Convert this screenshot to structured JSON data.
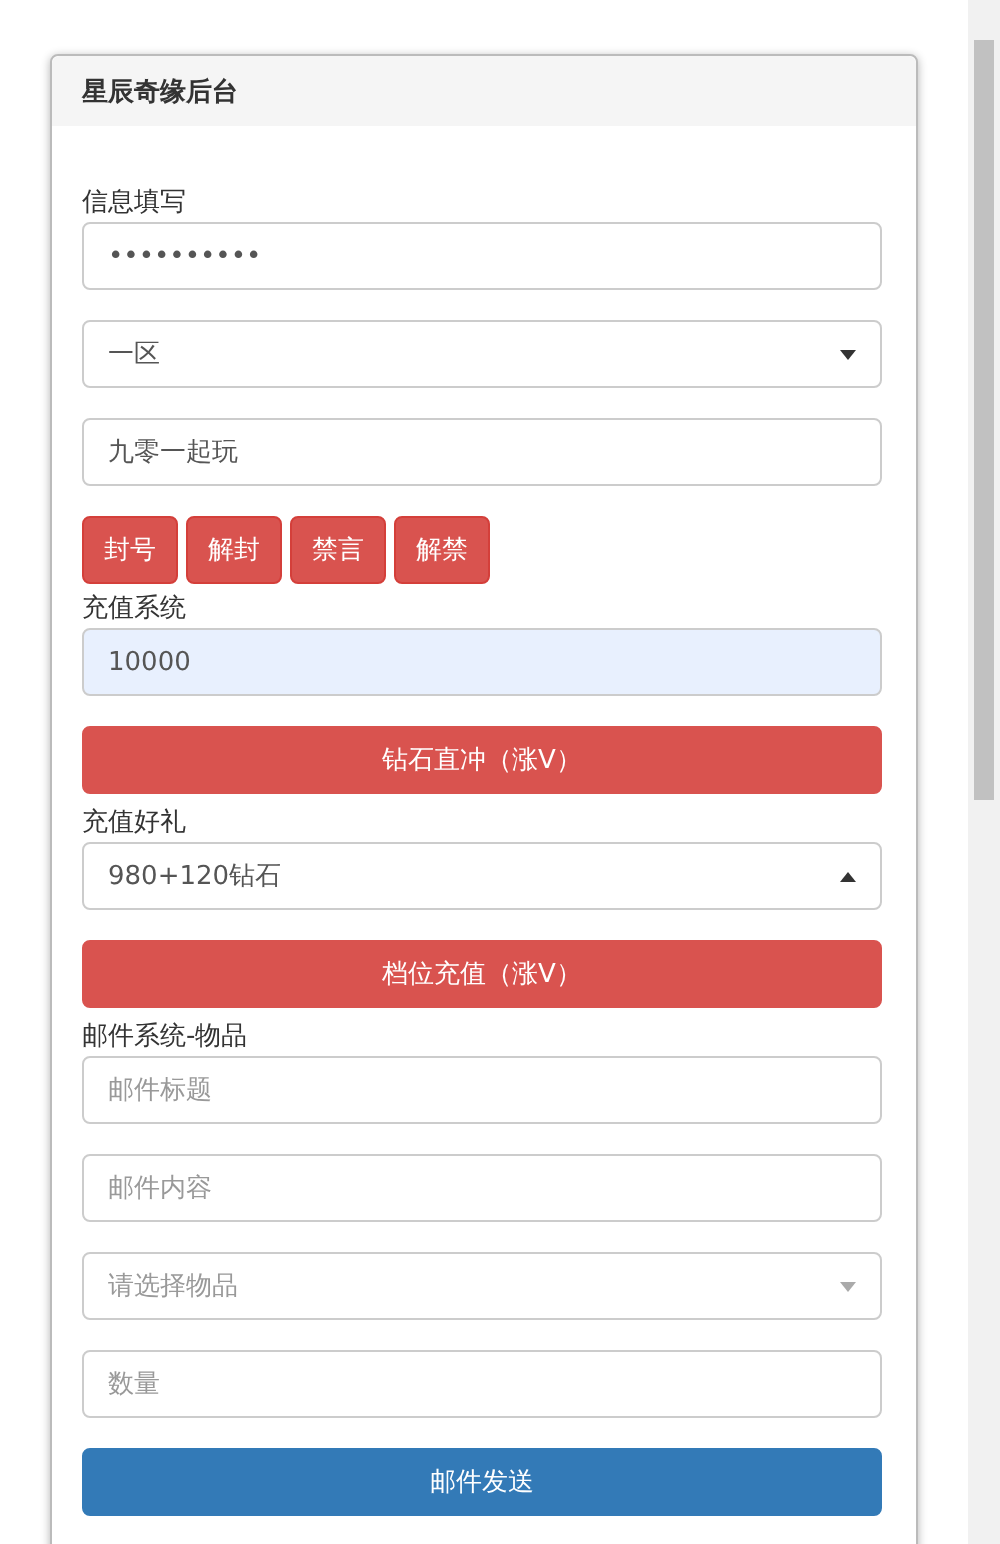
{
  "panel": {
    "title": "星辰奇缘后台"
  },
  "sections": [
    {
      "label": "信息填写",
      "items": [
        {
          "kind": "password",
          "value": "••••••••••"
        },
        {
          "kind": "select",
          "value": "一区",
          "expanded": false
        },
        {
          "kind": "text",
          "value": "九零一起玩"
        },
        {
          "kind": "buttons",
          "buttons": [
            "封号",
            "解封",
            "禁言",
            "解禁"
          ]
        }
      ]
    },
    {
      "label": "充值系统",
      "items": [
        {
          "kind": "text",
          "value": "10000",
          "autofilled": true
        },
        {
          "kind": "button",
          "label": "钻石直冲（涨V）",
          "color": "#d9534f"
        }
      ]
    },
    {
      "label": "充值好礼",
      "items": [
        {
          "kind": "select",
          "value": "980+120钻石",
          "expanded": true
        },
        {
          "kind": "button",
          "label": "档位充值（涨V）",
          "color": "#d9534f"
        }
      ]
    },
    {
      "label": "邮件系统-物品",
      "items": [
        {
          "kind": "text",
          "placeholder": "邮件标题"
        },
        {
          "kind": "text",
          "placeholder": "邮件内容"
        },
        {
          "kind": "select",
          "placeholder": "请选择物品",
          "expanded": false
        },
        {
          "kind": "text",
          "placeholder": "数量"
        },
        {
          "kind": "button",
          "label": "邮件发送",
          "color": "#337ab7"
        }
      ]
    }
  ]
}
